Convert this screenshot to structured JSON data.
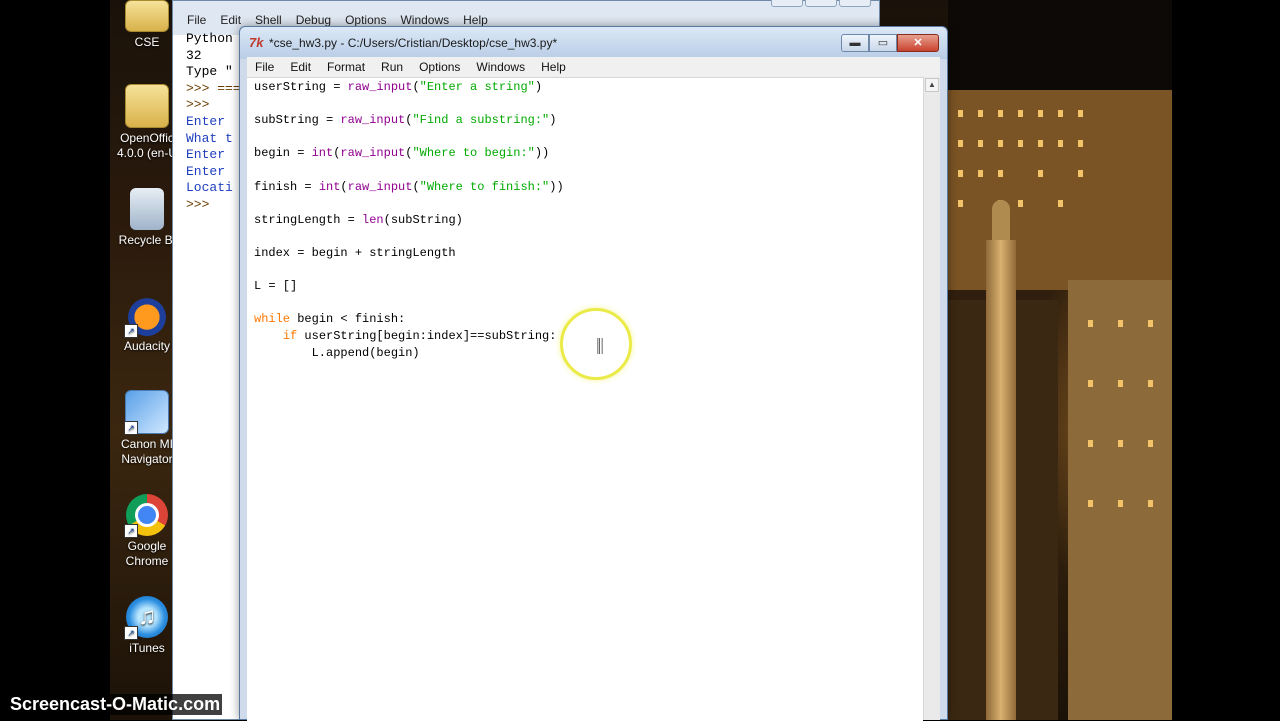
{
  "desktop": {
    "icons": [
      {
        "label": "CSE",
        "icon": "folder-icon"
      },
      {
        "label": "OpenOffic\n4.0.0 (en-U",
        "icon": "folder-icon"
      },
      {
        "label": "Recycle Bi",
        "icon": "recycle-bin-icon"
      },
      {
        "label": "Audacity",
        "icon": "audacity-icon"
      },
      {
        "label": "Canon MI\nNavigator",
        "icon": "canon-navigator-icon"
      },
      {
        "label": "Google\nChrome",
        "icon": "chrome-icon"
      },
      {
        "label": "iTunes",
        "icon": "itunes-icon"
      }
    ]
  },
  "shell": {
    "menu": [
      "File",
      "Edit",
      "Shell",
      "Debug",
      "Options",
      "Windows",
      "Help"
    ],
    "lines": [
      "Python",
      "32",
      "Type \"",
      ">>> ===",
      ">>>",
      "Enter",
      "What t",
      "Enter",
      "Enter",
      "Locati",
      ">>>"
    ]
  },
  "editor": {
    "title": "*cse_hw3.py - C:/Users/Cristian/Desktop/cse_hw3.py*",
    "logo": "7k",
    "menu": [
      "File",
      "Edit",
      "Format",
      "Run",
      "Options",
      "Windows",
      "Help"
    ],
    "buttons": {
      "minimize": "▬",
      "maximize": "▭",
      "close": "✕"
    }
  },
  "watermark": "Screencast-O-Matic.com"
}
